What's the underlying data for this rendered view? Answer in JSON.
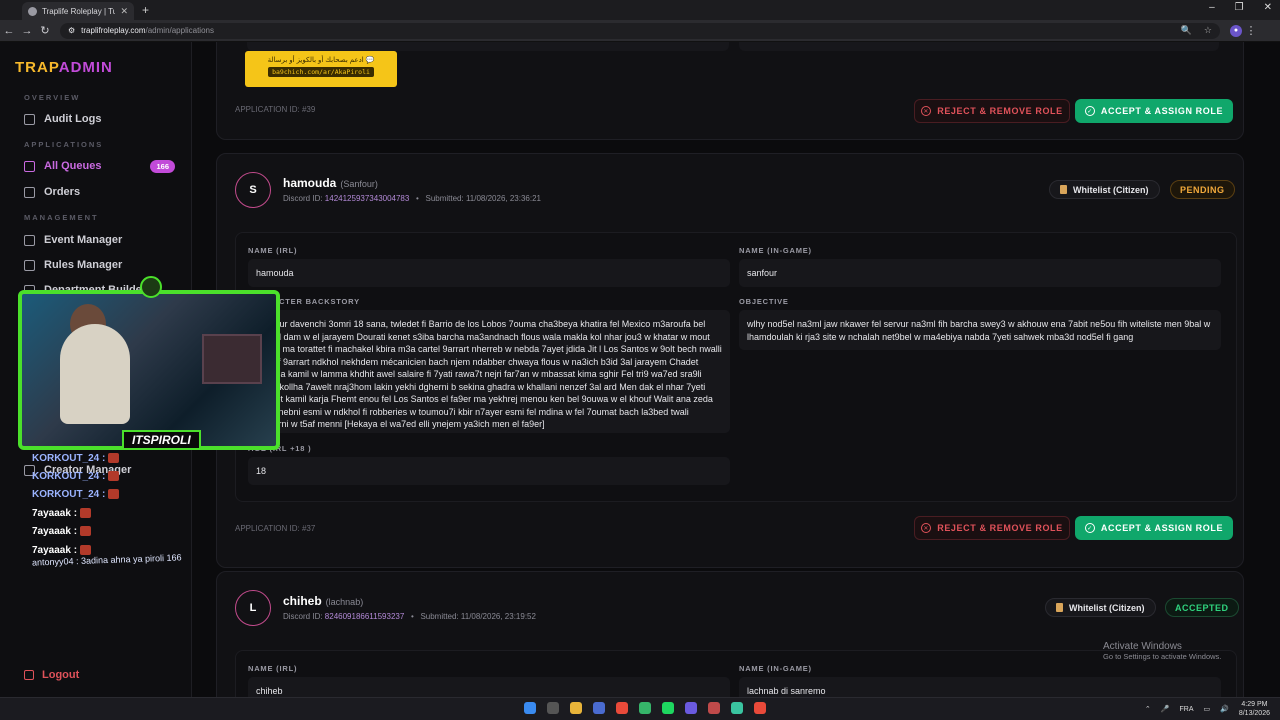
{
  "browser": {
    "tab_title": "Traplife Roleplay | Tunisian GTA",
    "url_host": "traplifroleplay.com",
    "url_path": "/admin/applications"
  },
  "sidebar": {
    "brand_a": "TRAP",
    "brand_b": "ADMIN",
    "section_overview": "OVERVIEW",
    "audit_logs": "Audit Logs",
    "section_applications": "APPLICATIONS",
    "all_queues": "All Queues",
    "all_queues_count": "166",
    "orders": "Orders",
    "section_management": "MANAGEMENT",
    "event_manager": "Event Manager",
    "rules_manager": "Rules Manager",
    "department_builder": "Department Builder",
    "creator_manager": "Creator Manager",
    "logout": "Logout"
  },
  "top_card": {
    "promo_text": "ادعم بصحابك أو بالكويز أو برسالة 💬",
    "promo_code": "ba9chich.com/ar/AkaPiroli",
    "app_id": "APPLICATION ID: #39",
    "reject_label": "REJECT & REMOVE ROLE",
    "accept_label": "ACCEPT & ASSIGN ROLE"
  },
  "app1": {
    "initial": "S",
    "name": "hamouda",
    "ingame": "(Sanfour)",
    "discord_label": "Discord ID:",
    "discord_id": "1424125937343004783",
    "submitted": "Submitted: 11/08/2026, 23:36:21",
    "tag": "Whitelist (Citizen)",
    "status": "PENDING",
    "name_irl_label": "NAME (IRL)",
    "name_irl": "hamouda",
    "name_ingame_label": "NAME (IN-GAME)",
    "name_ingame": "sanfour",
    "backstory_label": "CHARACTER BACKSTORY",
    "backstory": "Sanfour davenchi  3omri 18 sana, twledet fi Barrio de los Lobos 7ouma cha3beya khatira fel Mexico m3aroufa bel fa9r el dam w el jarayem  Dourati kenet s3iba barcha ma3andnach flous wala makla kol nhar jou3 w khatar w mout  Ommi ma torattet fi machakel kbira m3a cartel 9arrart nherreb w nebda 7ayet jdida Jit l Los Santos w 9olt bech nwalli nadhif  9arrart ndkhol nekhdem mécanicien bach njem ndabber chwaya flous w na3ich b3id 3al jarayem  Chadet l5edma kamil   w lamma khdhit awel salaire fi 7yati rawa7t nejri far7an w mbassat kima sghir Fel tri9  wa7ed sra9li flousi kollha  7awelt nraj3hom  lakin yekhi dgherni b sekina ghadra w khallani nenzef 3al ard Men dak el nhar 7yeti t9elbet kamil karja  Fhemt enou fel Los Santos  el fa9er ma yekhrej menou ken bel 9ouwa w el khouf Walit ana zeda n7eb nebni esmi w ndkhol fi robberies w toumou7i kbir  n7ayer esmi fel mdina w fel 7oumat bach la3bed twali t9adarni w t5af menni  [Hekaya el wa7ed elli ynejem ya3ich men el fa9er]",
    "objective_label": "OBJECTIVE",
    "objective": "wlhy nod5el na3ml jaw nkawer fel servur na3ml fih barcha swey3 w akhouw ena 7abit ne5ou fih witeliste men 9bal w lhamdoulah ki rja3 site w nchalah net9bel w ma4ebiya nabda 7yeti sahwek mba3d nod5el fi gang",
    "age_label": "AGE (IRL +18 )",
    "age": "18",
    "app_id": "APPLICATION ID: #37",
    "reject_label": "REJECT & REMOVE ROLE",
    "accept_label": "ACCEPT & ASSIGN ROLE"
  },
  "app2": {
    "initial": "L",
    "name": "chiheb",
    "ingame": "(lachnab)",
    "discord_label": "Discord ID:",
    "discord_id": "824609186611593237",
    "submitted": "Submitted: 11/08/2026, 23:19:52",
    "tag": "Whitelist (Citizen)",
    "status": "ACCEPTED",
    "name_irl_label": "NAME (IRL)",
    "name_irl": "chiheb",
    "name_ingame_label": "NAME (IN-GAME)",
    "name_ingame": "lachnab di sanremo"
  },
  "overlay": {
    "streamer": "ITSPIROLI",
    "chat": [
      {
        "user": "KORKOUT_24 :",
        "cls": "u1"
      },
      {
        "user": "KORKOUT_24 :",
        "cls": "u1"
      },
      {
        "user": "KORKOUT_24 :",
        "cls": "u1"
      },
      {
        "user": "7ayaaak :",
        "cls": "u2"
      },
      {
        "user": "7ayaaak :",
        "cls": "u2"
      },
      {
        "user": "7ayaaak :",
        "cls": "u2"
      }
    ],
    "chat_last": "antonyy04 : 3adina ahna ya piroli 166"
  },
  "watermark": {
    "title": "Activate Windows",
    "sub": "Go to Settings to activate Windows."
  },
  "taskbar": {
    "lang": "FRA",
    "time": "4:29 PM",
    "date": "8/13/2026"
  },
  "colors": {
    "brand_gold": "#f7b92c",
    "brand_purple": "#c24bd9",
    "accept_green": "#10a76b",
    "reject_red": "#e0525a",
    "pending_orange": "#f2a93b"
  }
}
